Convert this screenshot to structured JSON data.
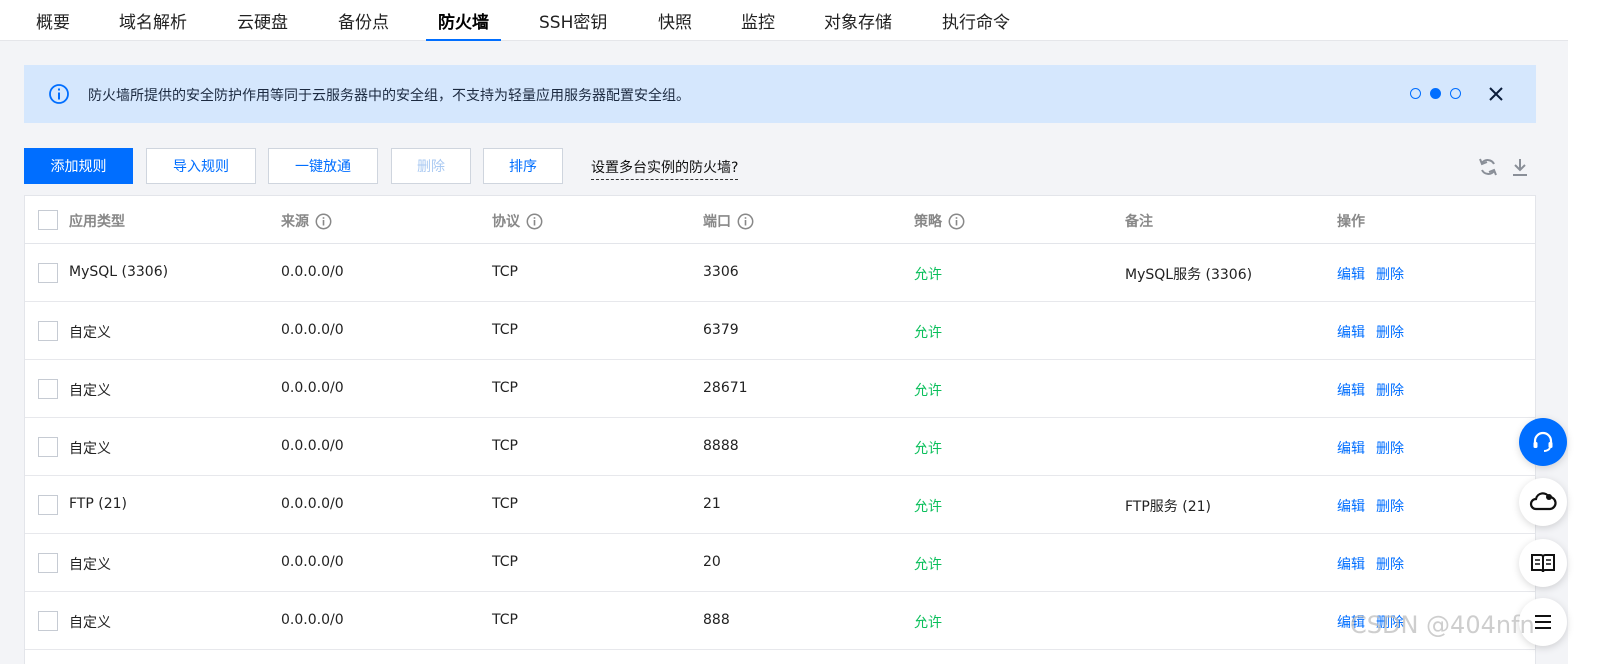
{
  "tabs": [
    "概要",
    "域名解析",
    "云硬盘",
    "备份点",
    "防火墙",
    "SSH密钥",
    "快照",
    "监控",
    "对象存储",
    "执行命令"
  ],
  "active_tab": "防火墙",
  "banner": {
    "message": "防火墙所提供的安全防护作用等同于云服务器中的安全组，不支持为轻量应用服务器配置安全组。",
    "page_indicator": {
      "total": 3,
      "current": 2
    }
  },
  "toolbar": {
    "add_rule": "添加规则",
    "import_rule": "导入规则",
    "one_click_open": "一键放通",
    "delete": "删除",
    "sort": "排序",
    "multi_instance_link": "设置多台实例的防火墙?"
  },
  "table": {
    "headers": {
      "app_type": "应用类型",
      "source": "来源",
      "protocol": "协议",
      "port": "端口",
      "policy": "策略",
      "note": "备注",
      "action": "操作"
    },
    "edit_label": "编辑",
    "delete_label": "删除",
    "rows": [
      {
        "app_type": "MySQL (3306)",
        "source": "0.0.0.0/0",
        "protocol": "TCP",
        "port": "3306",
        "policy": "允许",
        "note": "MySQL服务 (3306)"
      },
      {
        "app_type": "自定义",
        "source": "0.0.0.0/0",
        "protocol": "TCP",
        "port": "6379",
        "policy": "允许",
        "note": ""
      },
      {
        "app_type": "自定义",
        "source": "0.0.0.0/0",
        "protocol": "TCP",
        "port": "28671",
        "policy": "允许",
        "note": ""
      },
      {
        "app_type": "自定义",
        "source": "0.0.0.0/0",
        "protocol": "TCP",
        "port": "8888",
        "policy": "允许",
        "note": ""
      },
      {
        "app_type": "FTP (21)",
        "source": "0.0.0.0/0",
        "protocol": "TCP",
        "port": "21",
        "policy": "允许",
        "note": "FTP服务 (21)"
      },
      {
        "app_type": "自定义",
        "source": "0.0.0.0/0",
        "protocol": "TCP",
        "port": "20",
        "policy": "允许",
        "note": ""
      },
      {
        "app_type": "自定义",
        "source": "0.0.0.0/0",
        "protocol": "TCP",
        "port": "888",
        "policy": "允许",
        "note": ""
      }
    ]
  },
  "watermark": "CSDN @404nfn",
  "colors": {
    "accent": "#006eff",
    "allow": "#0abf5b",
    "banner_bg": "#d5e7fd"
  }
}
